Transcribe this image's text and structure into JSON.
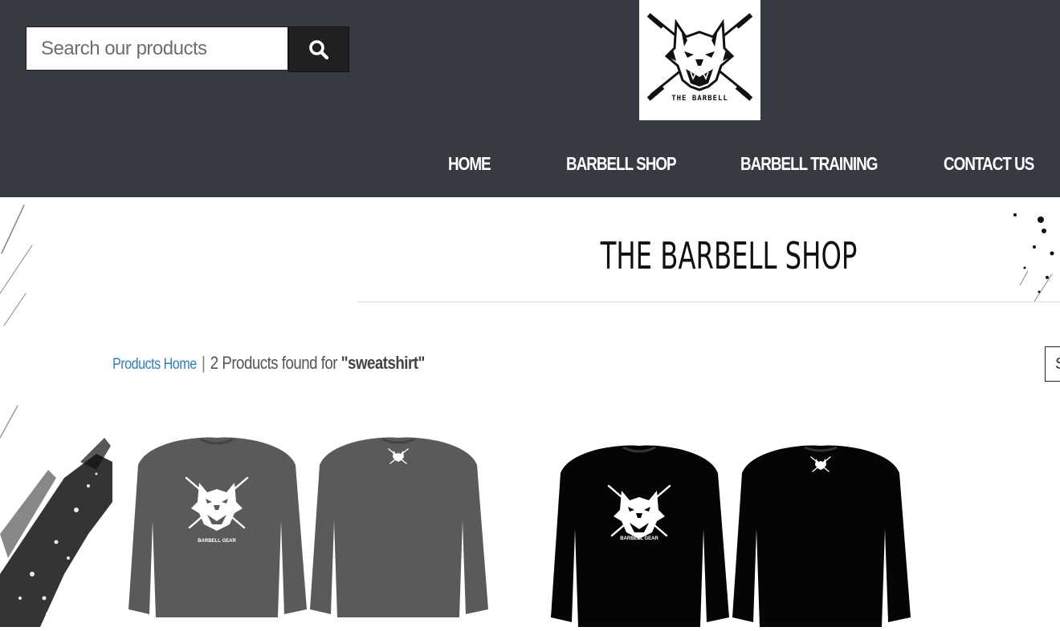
{
  "header": {
    "search": {
      "placeholder": "Search our products",
      "value": ""
    },
    "logo_text": "THE BARBELL",
    "nav": [
      {
        "label": "HOME"
      },
      {
        "label": "BARBELL SHOP"
      },
      {
        "label": "BARBELL TRAINING"
      },
      {
        "label": "CONTACT US"
      }
    ]
  },
  "page": {
    "title": "THE BARBELL SHOP"
  },
  "breadcrumb": {
    "home_link": "Products Home",
    "separator": "|",
    "result_text": "2 Products found for ",
    "search_term": "\"sweatshirt\"",
    "sort_partial": "S"
  },
  "products": [
    {
      "color_hex": "#5a5a5c",
      "print_text": "BARBELL GEAR"
    },
    {
      "color_hex": "#050505",
      "print_text": "BARBELL GEAR"
    }
  ],
  "colors": {
    "header_bg": "#363a42",
    "link_blue": "#2f7fc0",
    "search_button": "#202020"
  },
  "icons": [
    "search-icon",
    "wolf-barbell-logo"
  ]
}
